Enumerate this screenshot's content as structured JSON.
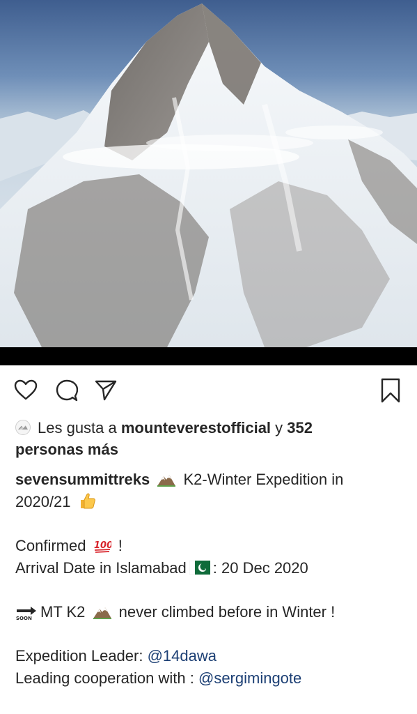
{
  "post": {
    "image_alt_icon": "mountain-photo",
    "likes": {
      "prefix": "Les gusta a",
      "user": "mounteverestofficial",
      "conj": "y",
      "count": "352",
      "suffix": "personas más"
    },
    "caption": {
      "username": "sevensummittreks",
      "line1_text": "K2-Winter Expedition in",
      "line2_text": "2020/21",
      "confirmed": "Confirmed",
      "confirmed_end": "!",
      "arrival_prefix": "Arrival Date in Islamabad",
      "arrival_suffix": ": 20 Dec 2020",
      "soon_text": "MT K2",
      "soon_rest": "never climbed before in Winter !",
      "leader_label": "Expedition Leader:",
      "leader_mention": "@14dawa",
      "coop_label": "Leading cooperation with :",
      "coop_mention": "@sergimingote"
    }
  },
  "icons": {
    "like": "heart-icon",
    "comment": "comment-icon",
    "share": "send-icon",
    "save": "bookmark-icon"
  }
}
